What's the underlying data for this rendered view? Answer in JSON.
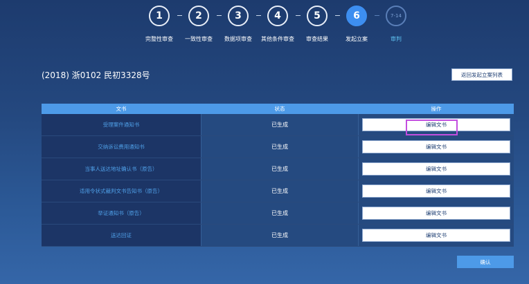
{
  "stepper": {
    "steps": [
      {
        "number": "1",
        "label": "完整性审查"
      },
      {
        "number": "2",
        "label": "一致性审查"
      },
      {
        "number": "3",
        "label": "数据项审查"
      },
      {
        "number": "4",
        "label": "其他条件审查"
      },
      {
        "number": "5",
        "label": "审查结果"
      },
      {
        "number": "6",
        "label": "发起立案"
      },
      {
        "number": "7-14",
        "label": "审判"
      }
    ],
    "active_step": "6"
  },
  "header": {
    "case_number": "(2018) 浙0102 民初3328号",
    "back_button": "返回发起立案列表"
  },
  "table": {
    "columns": [
      "文书",
      "状态",
      "操作"
    ],
    "rows": [
      {
        "document": "受理案件通知书",
        "status": "已生成",
        "action": "编辑文书"
      },
      {
        "document": "交纳诉讼费用通知书",
        "status": "已生成",
        "action": "编辑文书"
      },
      {
        "document": "当事人送达地址确认书（原告）",
        "status": "已生成",
        "action": "编辑文书"
      },
      {
        "document": "适用令状式裁判文书告知书（原告）",
        "status": "已生成",
        "action": "编辑文书"
      },
      {
        "document": "举证通知书（原告）",
        "status": "已生成",
        "action": "编辑文书"
      },
      {
        "document": "送达回证",
        "status": "已生成",
        "action": "编辑文书"
      }
    ]
  },
  "footer": {
    "confirm_button": "确认"
  },
  "colors": {
    "accent": "#4d9ae8",
    "active_step": "#3d8ef0",
    "highlight": "#c34ee0"
  }
}
